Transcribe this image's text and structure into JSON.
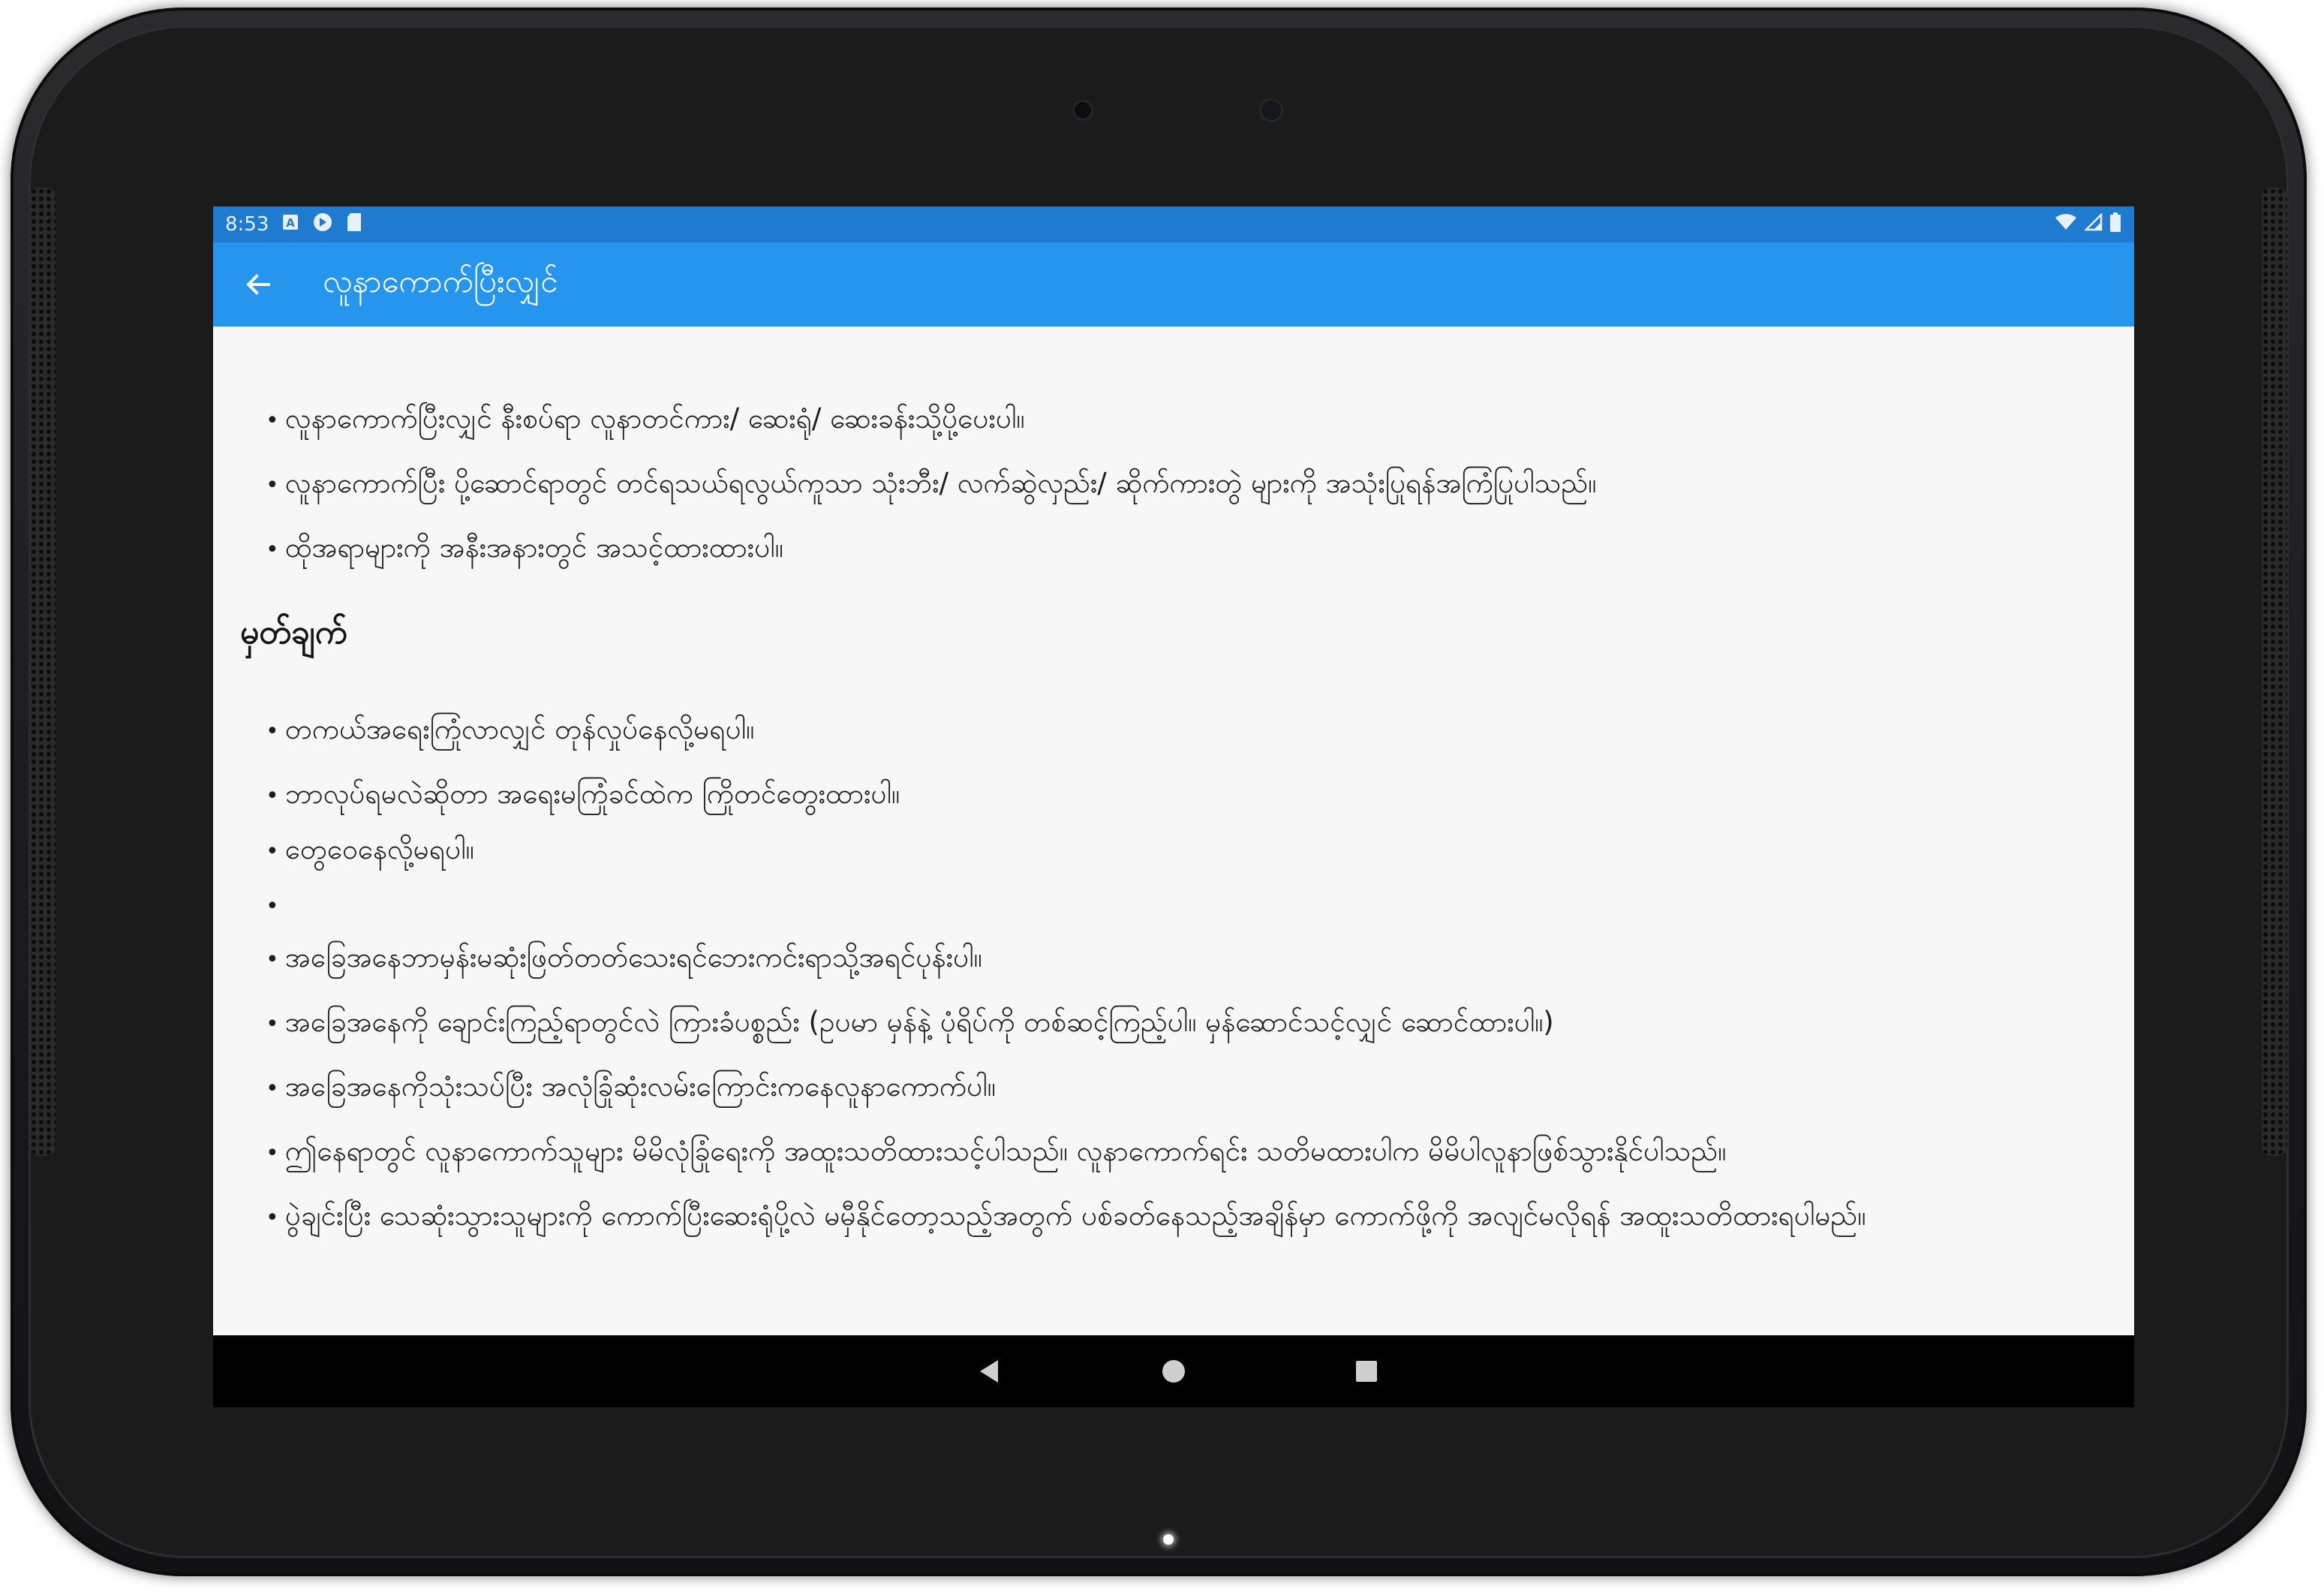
{
  "status_bar": {
    "time": "8:53",
    "icons_left": [
      "a-icon",
      "play-protect-icon",
      "sd-card-icon"
    ],
    "icons_right": [
      "wifi-icon",
      "signal-icon",
      "battery-icon"
    ]
  },
  "app_bar": {
    "back_icon": "arrow-left-icon",
    "title": "လူနာကောက်ပြီးလျှင်"
  },
  "content": {
    "bullet": "•",
    "section1": [
      "လူနာကောက်ပြီးလျှင် နီးစပ်ရာ လူနာတင်ကား/ ဆေးရုံ/ ဆေးခန်းသို့ပို့ပေးပါ။",
      "လူနာကောက်ပြီး ပို့ဆောင်ရာတွင် တင်ရသယ်ရလွယ်ကူသာ သုံးဘီး/ လက်ဆွဲလှည်း/ ဆိုက်ကားတွဲ များကို အသုံးပြုရန်အကြံပြုပါသည်။",
      "ထိုအရာများကို အနီးအနားတွင် အသင့်ထားထားပါ။"
    ],
    "notes_heading": "မှတ်ချက်",
    "section2": [
      "တကယ်အရေးကြုံလာလျှင် တုန်လှုပ်နေလို့မရပါ။",
      "ဘာလုပ်ရမလဲဆိုတာ အရေးမကြုံခင်ထဲက ကြိုတင်တွေးထားပါ။",
      "တွေဝေနေလို့မရပါ။",
      "",
      "အခြေအနေဘာမှန်းမဆုံးဖြတ်တတ်သေးရင်ဘေးကင်းရာသို့အရင်ပုန်းပါ။",
      "အခြေအနေကို ချောင်းကြည့်ရာတွင်လဲ ကြားခံပစ္စည်း (ဥပမာ မှန်နဲ့ ပုံရိပ်ကို တစ်ဆင့်ကြည့်ပါ။ မှန်ဆောင်သင့်လျှင် ဆောင်ထားပါ။)",
      "အခြေအနေကိုသုံးသပ်ပြီး အလုံခြုံဆုံးလမ်းကြောင်းကနေလူနာကောက်ပါ။",
      "ဤနေရာတွင် လူနာကောက်သူများ မိမိလုံခြုံရေးကို အထူးသတိထားသင့်ပါသည်။ လူနာကောက်ရင်း သတိမထားပါက မိမိပါလူနာဖြစ်သွားနိုင်ပါသည်။",
      "ပွဲချင်းပြီး သေဆုံးသွားသူများကို ကောက်ပြီးဆေးရုံပို့လဲ မမှီနိုင်တော့သည့်အတွက် ပစ်ခတ်နေသည့်အချိန်မှာ ကောက်ဖို့ကို အလျင်မလိုရန် အထူးသတိထားရပါမည်။"
    ]
  },
  "nav_bar": {
    "buttons": [
      "back-triangle-icon",
      "home-circle-icon",
      "recents-square-icon"
    ]
  },
  "colors": {
    "app_bar": "#2595ee",
    "status_bar": "#1f7bd0",
    "content_bg": "#f7f7f7",
    "nav_bar": "#000000",
    "device_frame": "#1c1c1e"
  }
}
